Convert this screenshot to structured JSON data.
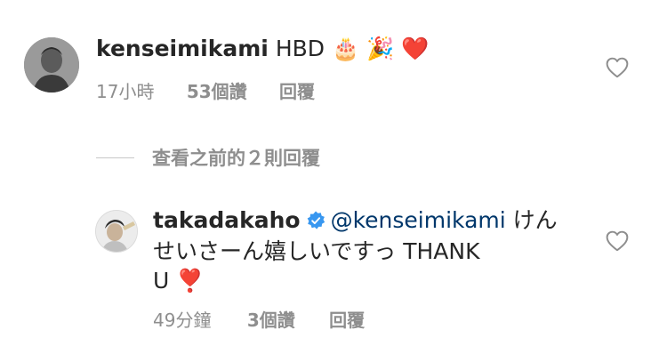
{
  "comment1": {
    "username": "kenseimikami",
    "text": "HBD",
    "emojis": [
      "🎂",
      "🎉",
      "❤️"
    ],
    "time": "17小時",
    "likes": "53個讚",
    "reply": "回覆",
    "avatar_icon": "user-avatar-photo",
    "like_icon": "heart-outline-icon"
  },
  "view_replies": {
    "label": "查看之前的２則回覆"
  },
  "comment2": {
    "username": "takadakaho",
    "verified_icon": "verified-badge-icon",
    "verified_color": "#3897f0",
    "mention": "@kenseimikami",
    "text_line1": "けん",
    "text_line2": "せいさーん嬉しいですっ THANK",
    "text_line3": "U",
    "emoji": "❣️",
    "time": "49分鐘",
    "likes": "3個讚",
    "reply": "回覆",
    "avatar_icon": "user-avatar-photo",
    "like_icon": "heart-outline-icon"
  },
  "colors": {
    "text": "#262626",
    "secondary": "#8e8e8e",
    "mention": "#00376b",
    "heart_red": "#ed4956"
  }
}
